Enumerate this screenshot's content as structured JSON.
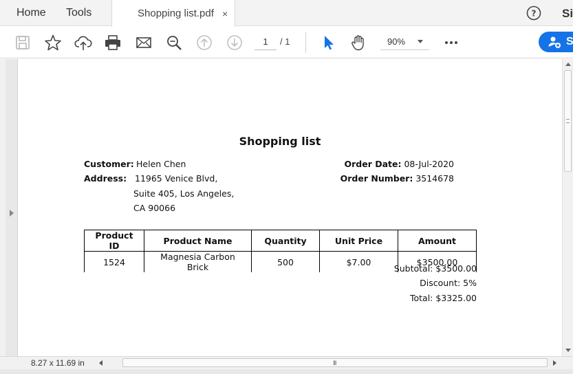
{
  "tabs": {
    "home": "Home",
    "tools": "Tools",
    "document": "Shopping list.pdf",
    "close": "×",
    "signin": "Si"
  },
  "toolbar": {
    "icons": [
      "save-icon",
      "star-icon",
      "cloud-upload-icon",
      "print-icon",
      "mail-icon",
      "zoom-search-icon",
      "page-up-icon",
      "page-down-icon",
      "select-cursor-icon",
      "hand-pan-icon",
      "more-icon"
    ],
    "current_page": "1",
    "total_pages": "/ 1",
    "zoom": "90%",
    "share_label": "S",
    "accent_color": "#1473e6"
  },
  "status": {
    "page_size": "8.27 x 11.69 in",
    "scroll_grip": "III"
  },
  "document": {
    "title": "Shopping list",
    "customer_label": "Customer:",
    "customer_name": "Helen Chen",
    "address_label": "Address:",
    "address_lines": [
      "11965 Venice Blvd,",
      "Suite 405, Los Angeles,",
      "CA 90066"
    ],
    "order_date_label": "Order Date:",
    "order_date": "08-Jul-2020",
    "order_number_label": "Order Number:",
    "order_number": "3514678",
    "table": {
      "headers": [
        "Product ID",
        "Product Name",
        "Quantity",
        "Unit Price",
        "Amount"
      ],
      "rows": [
        [
          "1524",
          "Magnesia Carbon Brick",
          "500",
          "$7.00",
          "$3500.00"
        ]
      ]
    },
    "subtotal": "Subtotal: $3500.00",
    "discount": "Discount: 5%",
    "total": "Total:  $3325.00"
  }
}
